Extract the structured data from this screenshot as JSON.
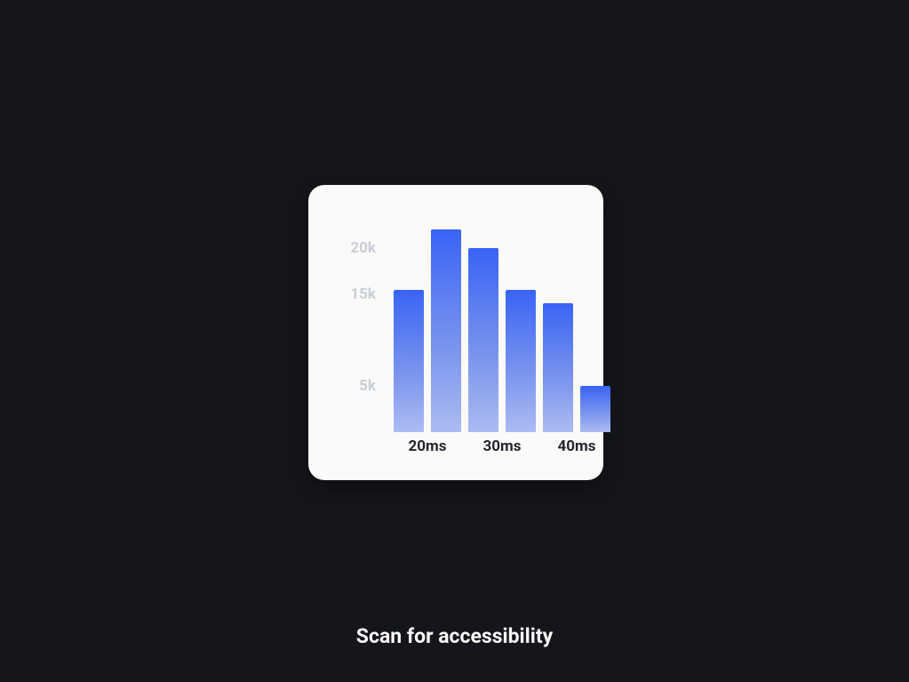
{
  "chart_data": {
    "type": "bar",
    "categories_numeric_ms": [
      17.5,
      22.5,
      27.5,
      32.5,
      37.5,
      42.5
    ],
    "values": [
      15500,
      22000,
      20000,
      15500,
      14000,
      5000
    ],
    "y_ticks": [
      {
        "label": "20k",
        "value": 20000
      },
      {
        "label": "15k",
        "value": 15000
      },
      {
        "label": "5k",
        "value": 5000
      }
    ],
    "x_ticks": [
      {
        "label": "20ms",
        "at_ms": 20
      },
      {
        "label": "30ms",
        "at_ms": 30
      },
      {
        "label": "40ms",
        "at_ms": 40
      }
    ],
    "y_max": 23000,
    "x_range_ms": [
      15,
      45
    ],
    "title": "",
    "xlabel": "",
    "ylabel": ""
  },
  "footer": {
    "label": "Scan for accessibility"
  }
}
